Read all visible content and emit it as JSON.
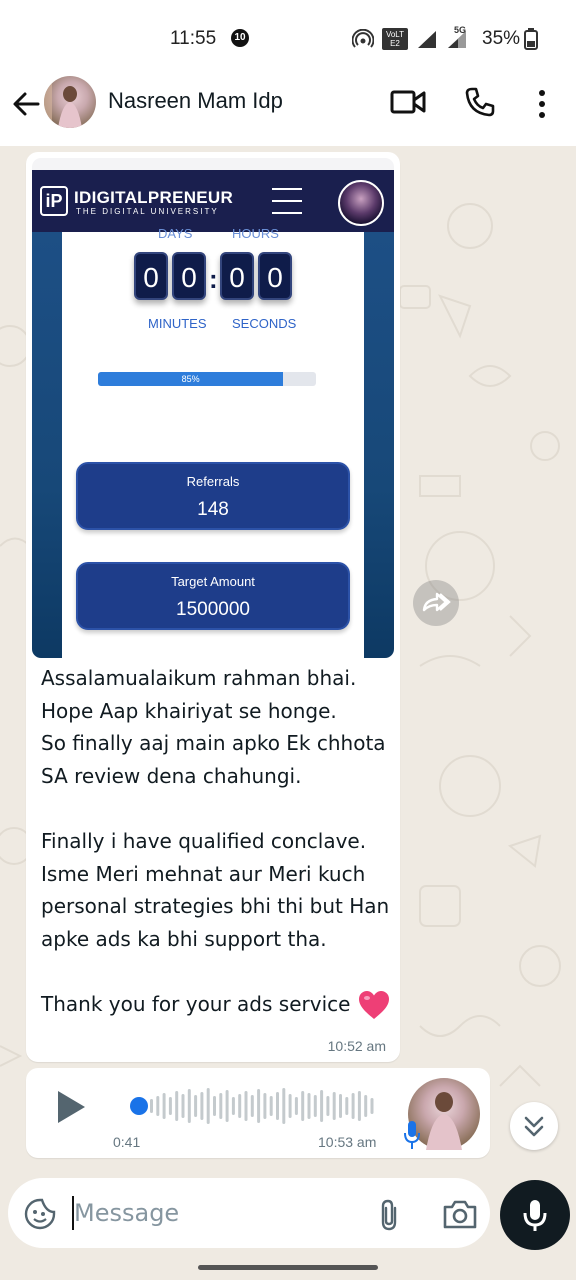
{
  "status_bar": {
    "time": "11:55",
    "notification_count": "10",
    "lte_label": "VoLTE2",
    "network_label": "5G",
    "battery": "35%"
  },
  "header": {
    "contact_name": "Nasreen Mam Idp"
  },
  "image": {
    "brand": "IDIGITALPRENEUR",
    "tagline": "THE DIGITAL UNIVERSITY",
    "logo_letters": "iP",
    "faded_labels": [
      "DAYS",
      "HOURS"
    ],
    "digits": [
      "0",
      "0",
      "0",
      "0"
    ],
    "time_labels": [
      "MINUTES",
      "SECONDS"
    ],
    "progress_value": 0.85,
    "progress_label": "85%",
    "referrals_label": "Referrals",
    "referrals_value": "148",
    "target_label": "Target Amount",
    "target_value": "1500000"
  },
  "message": {
    "text": "Assalamualaikum rahman bhai.\nHope Aap khairiyat se honge.\nSo finally aaj main apko Ek chhota SA review dena chahungi.\n\nFinally i have qualified conclave. Isme Meri mehnat aur Meri kuch personal strategies bhi thi but Han apke ads ka bhi support tha.\n\nThank you for your ads service",
    "time": "10:52 am"
  },
  "voice_note": {
    "duration": "0:41",
    "time": "10:53 am"
  },
  "composer": {
    "placeholder": "Message"
  },
  "colors": {
    "wallpaper": "#efeae2",
    "idp_navy": "#1a1f4e",
    "accent_blue": "#2e7ddb",
    "voice_dot": "#1a73e8"
  }
}
